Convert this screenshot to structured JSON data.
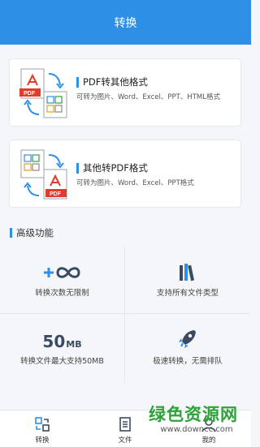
{
  "header": {
    "title": "转换"
  },
  "cards": [
    {
      "title": "PDF转其他格式",
      "desc": "可转为图片、Word、Excel、PPT、HTML格式",
      "badge": "PDF"
    },
    {
      "title": "其他转PDF格式",
      "desc": "可转为图片、Word、Excel、PPT格式",
      "badge": "PDF"
    }
  ],
  "advanced": {
    "title": "高级功能",
    "features": [
      {
        "label": "转换次数无限制",
        "icon": "infinity-plus-icon"
      },
      {
        "label": "支持所有文件类型",
        "icon": "books-icon"
      },
      {
        "label": "转换文件最大支持50MB",
        "icon": "50mb-icon",
        "value": "50",
        "unit": "MB"
      },
      {
        "label": "极速转换，无需排队",
        "icon": "rocket-icon"
      }
    ]
  },
  "tabs": [
    {
      "label": "转换",
      "icon": "convert-icon"
    },
    {
      "label": "文件",
      "icon": "file-icon"
    },
    {
      "label": "我的",
      "icon": "user-icon"
    }
  ],
  "watermark": {
    "text": "绿色资源网",
    "site": "www.downcc.com"
  },
  "colors": {
    "accent": "#2e8fe6",
    "pdf_red": "#e23b2e",
    "watermark_green": "#2fa13a"
  }
}
